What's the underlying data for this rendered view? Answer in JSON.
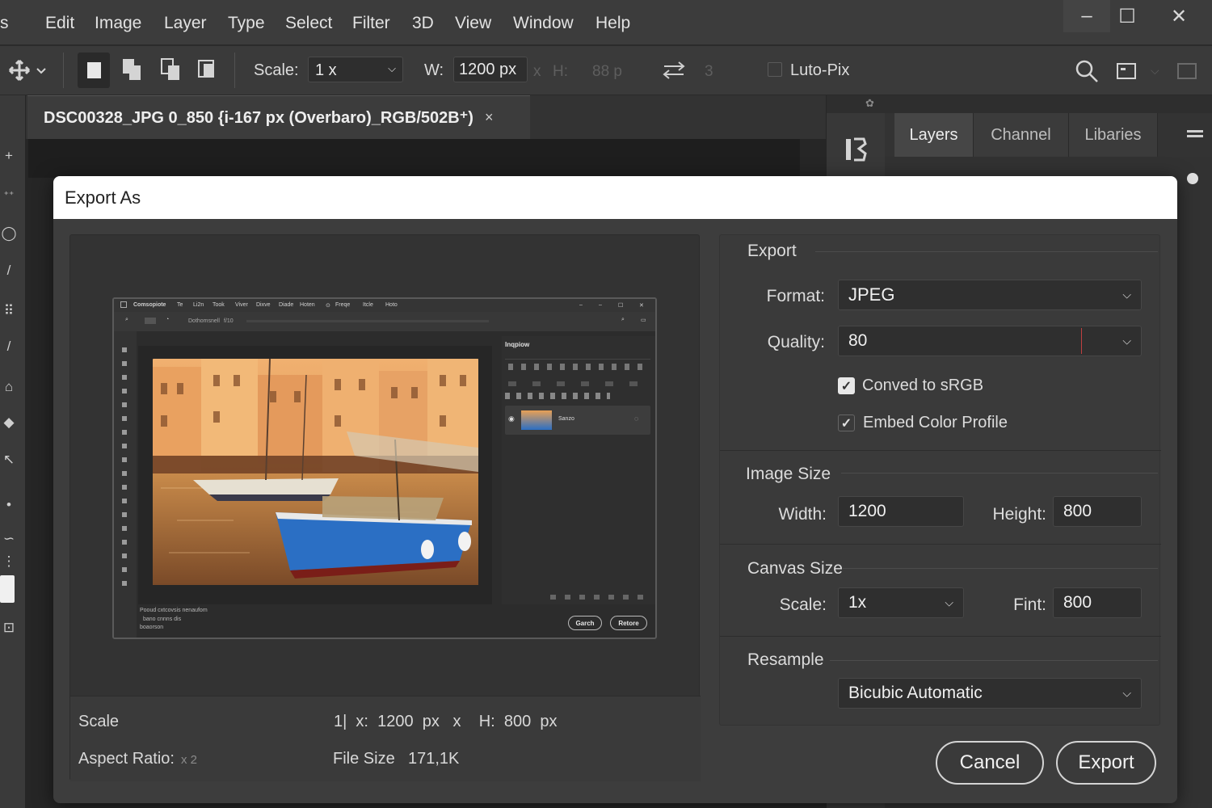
{
  "menu": [
    "Edit",
    "Image",
    "Layer",
    "Type",
    "Select",
    "Filter",
    "3D",
    "View",
    "Window",
    "Help"
  ],
  "menu_partial": "s",
  "window_controls": {
    "minimize": "–",
    "maximize": "☐",
    "close": "✕"
  },
  "options_bar": {
    "scale_label": "Scale:",
    "scale_value": "1 x",
    "w_label": "W:",
    "w_value": "1200 px",
    "times": "x",
    "h_label": "H:",
    "h_value": "88 p",
    "num": "3",
    "luto_label": "Luto-Pix"
  },
  "document_tab": {
    "title": "DSC00328_JPG 0_850 {i-167 px (Overbaro)_RGB/502B⁺)",
    "close": "×"
  },
  "right_panel": {
    "tabs": [
      "Layers",
      "Channel",
      "Libaries"
    ],
    "active_tab": "Layers"
  },
  "dialog": {
    "title": "Export As",
    "preview_footer": {
      "scale_label": "Scale",
      "scale_info": "1|  x:  1200  px   x    H:  800  px",
      "aspect_label": "Aspect  Ratio:",
      "aspect_value": "x 2",
      "filesize_label": "File Size",
      "filesize_value": "171,1K"
    },
    "mini_screenshot": {
      "app": "Comsopiote",
      "menus": [
        "Te",
        "Li2n",
        "Took",
        "Viver",
        "Dixve",
        "Diade",
        "Hoten",
        "Freqe",
        "Itcle",
        "Hoto"
      ],
      "opt_text": "Dothomsnell",
      "opt_num": "f/10",
      "panel_title": "Inqpiow",
      "layer_name": "Sanzo",
      "status_lines": [
        "Pooud      cxtcovsis nenaufom",
        "bano cnnns  dis",
        "boaorson"
      ],
      "btn_left": "Garch",
      "btn_right": "Retore"
    },
    "export": {
      "section_title": "Export",
      "format_label": "Format:",
      "format_value": "JPEG",
      "quality_label": "Quality:",
      "quality_value": "80",
      "convert_label": "Conved to sRGB",
      "convert_checked": true,
      "embed_label": "Embed Color Profile",
      "embed_checked": true
    },
    "image_size": {
      "section_title": "Image Size",
      "width_label": "Width:",
      "width_value": "1200",
      "height_label": "Height:",
      "height_value": "800"
    },
    "canvas_size": {
      "section_title": "Canvas Size",
      "scale_label": "Scale:",
      "scale_value": "1x",
      "fint_label": "Fint:",
      "fint_value": "800"
    },
    "resample": {
      "section_title": "Resample",
      "value": "Bicubic Automatic"
    },
    "buttons": {
      "cancel": "Cancel",
      "export": "Export"
    }
  },
  "colors": {
    "app_bg": "#2b2b2b",
    "menubar": "#3c3c3c",
    "dialog_bg": "#3d3d3d",
    "dialog_header": "#ffffff",
    "boat_blue": "#2b6fc4",
    "photo_warm": "#e8a055"
  }
}
